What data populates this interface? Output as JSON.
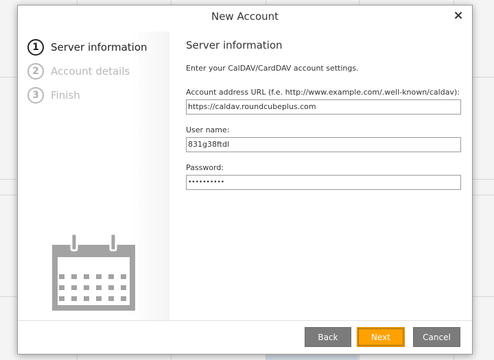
{
  "dialog": {
    "title": "New Account",
    "close_glyph": "×"
  },
  "steps": [
    {
      "num": "1",
      "label": "Server information",
      "active": true
    },
    {
      "num": "2",
      "label": "Account details",
      "active": false
    },
    {
      "num": "3",
      "label": "Finish",
      "active": false
    }
  ],
  "illustration": {
    "icon": "calendar-icon"
  },
  "form": {
    "section_title": "Server information",
    "description": "Enter your CalDAV/CardDAV account settings.",
    "url": {
      "label": "Account address URL (f.e. http://www.example.com/.well-known/caldav):",
      "value": "https://caldav.roundcubeplus.com"
    },
    "username": {
      "label": "User name:",
      "value": "831g38ftdl"
    },
    "password": {
      "label": "Password:",
      "value": "••••••••••"
    }
  },
  "footer": {
    "back_label": "Back",
    "next_label": "Next",
    "cancel_label": "Cancel"
  },
  "colors": {
    "accent": "#ffa200",
    "button_gray": "#7b7b7b"
  }
}
